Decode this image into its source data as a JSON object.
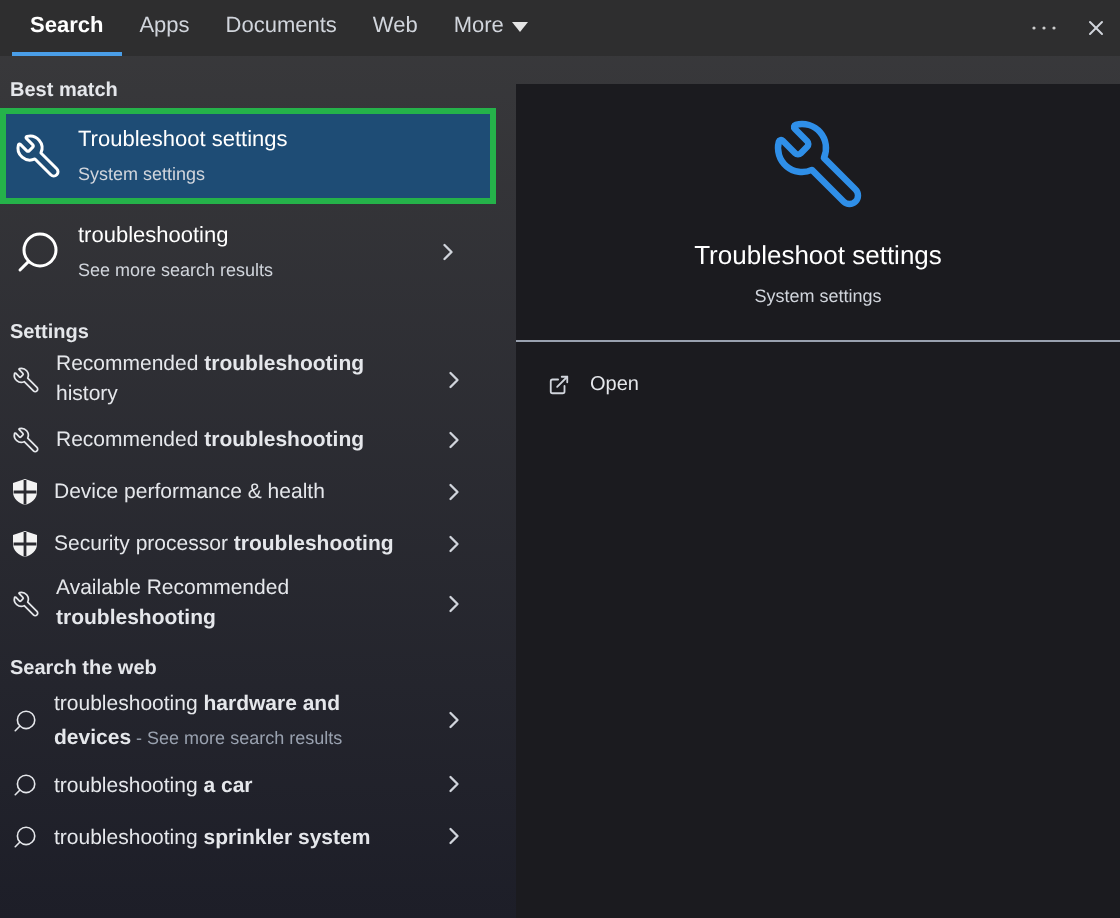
{
  "tabs": [
    {
      "label": "Search",
      "kind": "tab",
      "selected": true
    },
    {
      "label": "Apps",
      "kind": "tab",
      "selected": false
    },
    {
      "label": "Documents",
      "kind": "tab",
      "selected": false
    },
    {
      "label": "Web",
      "kind": "tab",
      "selected": false
    },
    {
      "label": "More",
      "kind": "menu",
      "selected": false
    }
  ],
  "best_match": {
    "heading": "Best match",
    "items": [
      {
        "kind": "app",
        "title": "Troubleshoot settings",
        "subtitle": "System settings",
        "selected": true
      },
      {
        "kind": "search",
        "title": "troubleshooting",
        "subtitle": "See more search results",
        "selected": false
      }
    ]
  },
  "settings": {
    "heading": "Settings",
    "items": [
      {
        "kind": "wrench",
        "text": "Recommended **troubleshooting** history"
      },
      {
        "kind": "wrench",
        "text": "Recommended **troubleshooting**"
      },
      {
        "kind": "shield",
        "text": "Device performance & health"
      },
      {
        "kind": "shield",
        "text": "Security processor **troubleshooting**"
      },
      {
        "kind": "wrench",
        "text": "Available Recommended **troubleshooting**"
      }
    ]
  },
  "web": {
    "heading": "Search the web",
    "items": [
      {
        "text": "troubleshooting **hardware and devices**",
        "hint": "- See more search results"
      },
      {
        "text": "troubleshooting **a car**"
      },
      {
        "text": "troubleshooting **sprinkler system**"
      }
    ]
  },
  "preview": {
    "title": "Troubleshoot settings",
    "subtitle": "System settings",
    "actions": [
      {
        "label": "Open"
      }
    ]
  }
}
